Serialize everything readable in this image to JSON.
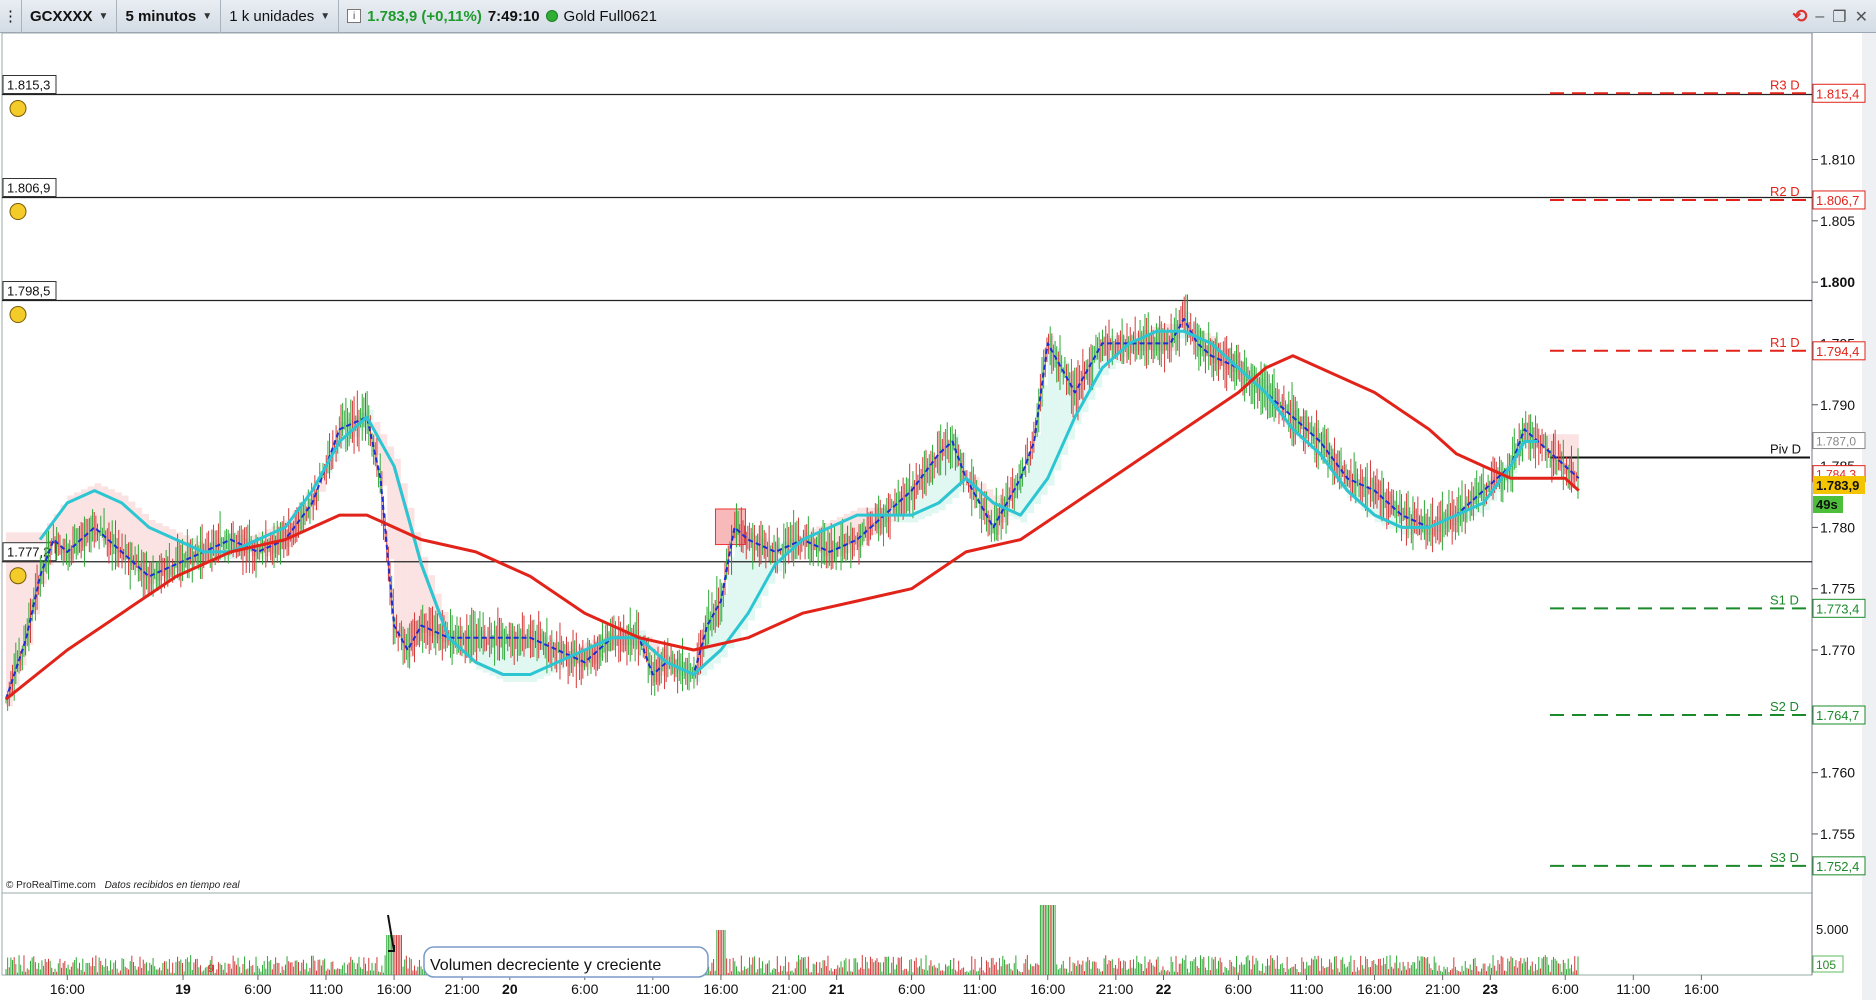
{
  "toolbar": {
    "instrument": "GCXXXX",
    "timeframe": "5 minutos",
    "units": "1 k unidades",
    "price_info": "1.783,9 (+0,11%)",
    "clock": "7:49:10",
    "feed_name": "Gold Full0621"
  },
  "icons": [
    "grip-icon",
    "info-icon",
    "status-dot-icon",
    "sync-icon",
    "minimize-icon",
    "restore-icon",
    "close-icon",
    "bell-icon",
    "arrow-icon"
  ],
  "colors": {
    "sma_slow": "#e2231a",
    "ema_fast": "#2cc6d2",
    "ma_gray": "#999999",
    "dashed_blue": "#1b2fd4",
    "resistance": "#e2231a",
    "support": "#1a8a2a",
    "up_candle": "#2ea836",
    "down_candle": "#d23a3a",
    "last_price_bg": "#f5c400"
  },
  "price_chart": {
    "y_ticks": [
      "1.810",
      "1.805",
      "1.800",
      "1.795",
      "1.790",
      "1.785",
      "1.780",
      "1.775",
      "1.770",
      "1.765",
      "1.760",
      "1.755"
    ],
    "y_min": 1751.0,
    "y_max": 1819.5,
    "horizontal_lines": [
      {
        "label": "1.815,3",
        "value": 1815.3
      },
      {
        "label": "1.806,9",
        "value": 1806.9
      },
      {
        "label": "1.798,5",
        "value": 1798.5
      },
      {
        "label": "1.777,2",
        "value": 1777.2
      }
    ],
    "pivots": [
      {
        "name": "R3 D",
        "value": 1815.4,
        "label": "1.815,4",
        "type": "resistance"
      },
      {
        "name": "R2 D",
        "value": 1806.7,
        "label": "1.806,7",
        "type": "resistance"
      },
      {
        "name": "R1 D",
        "value": 1794.4,
        "label": "1.794,4",
        "type": "resistance"
      },
      {
        "name": "Piv D",
        "value": 1785.7,
        "label": "",
        "type": "pivot"
      },
      {
        "name": "S1 D",
        "value": 1773.4,
        "label": "1.773,4",
        "type": "support"
      },
      {
        "name": "S2 D",
        "value": 1764.7,
        "label": "1.764,7",
        "type": "support"
      },
      {
        "name": "S3 D",
        "value": 1752.4,
        "label": "1.752,4",
        "type": "support"
      }
    ],
    "side_labels": [
      {
        "value": 1787.0,
        "label": "1.787,0"
      },
      {
        "value": 1784.3,
        "label": "1.784,3"
      }
    ],
    "last_price": "1.783,9",
    "countdown": "49s",
    "footer_brand": "© ProRealTime.com",
    "footer_note": "Datos recibidos en tiempo real"
  },
  "volume_chart": {
    "y_tick": "5.000",
    "last_volume": "105",
    "annotation": "Volumen decreciente y creciente",
    "signal_digit": "9"
  },
  "x_axis": {
    "ticks": [
      {
        "label": "16:00",
        "bold": false,
        "t": 0.0
      },
      {
        "label": "19",
        "bold": true,
        "t": 8.5
      },
      {
        "label": "6:00",
        "bold": false,
        "t": 14.0
      },
      {
        "label": "11:00",
        "bold": false,
        "t": 19.0
      },
      {
        "label": "16:00",
        "bold": false,
        "t": 24.0
      },
      {
        "label": "21:00",
        "bold": false,
        "t": 29.0
      },
      {
        "label": "20",
        "bold": true,
        "t": 32.5
      },
      {
        "label": "6:00",
        "bold": false,
        "t": 38.0
      },
      {
        "label": "11:00",
        "bold": false,
        "t": 43.0
      },
      {
        "label": "16:00",
        "bold": false,
        "t": 48.0
      },
      {
        "label": "21:00",
        "bold": false,
        "t": 53.0
      },
      {
        "label": "21",
        "bold": true,
        "t": 56.5
      },
      {
        "label": "6:00",
        "bold": false,
        "t": 62.0
      },
      {
        "label": "11:00",
        "bold": false,
        "t": 67.0
      },
      {
        "label": "16:00",
        "bold": false,
        "t": 72.0
      },
      {
        "label": "21:00",
        "bold": false,
        "t": 77.0
      },
      {
        "label": "22",
        "bold": true,
        "t": 80.5
      },
      {
        "label": "6:00",
        "bold": false,
        "t": 86.0
      },
      {
        "label": "11:00",
        "bold": false,
        "t": 91.0
      },
      {
        "label": "16:00",
        "bold": false,
        "t": 96.0
      },
      {
        "label": "21:00",
        "bold": false,
        "t": 101.0
      },
      {
        "label": "23",
        "bold": true,
        "t": 104.5
      },
      {
        "label": "6:00",
        "bold": false,
        "t": 110.0
      },
      {
        "label": "11:00",
        "bold": false,
        "t": 115.0
      },
      {
        "label": "16:00",
        "bold": false,
        "t": 120.0
      }
    ]
  },
  "chart_data": {
    "type": "line",
    "x_unit": "hours since first label (16:00 day 18)",
    "series": [
      {
        "kind": "price",
        "points": [
          [
            -4.5,
            1766
          ],
          [
            -3,
            1771
          ],
          [
            -2,
            1776
          ],
          [
            -1,
            1779
          ],
          [
            0,
            1778
          ],
          [
            2,
            1780
          ],
          [
            4,
            1778
          ],
          [
            6,
            1776
          ],
          [
            8,
            1777
          ],
          [
            10,
            1778
          ],
          [
            12,
            1779
          ],
          [
            14,
            1778
          ],
          [
            16,
            1779
          ],
          [
            18,
            1782
          ],
          [
            20,
            1788
          ],
          [
            22,
            1789
          ],
          [
            23,
            1784
          ],
          [
            24,
            1772
          ],
          [
            25,
            1770
          ],
          [
            26,
            1772
          ],
          [
            28,
            1771
          ],
          [
            30,
            1771
          ],
          [
            32,
            1771
          ],
          [
            34,
            1771
          ],
          [
            36,
            1770
          ],
          [
            38,
            1769
          ],
          [
            40,
            1771
          ],
          [
            42,
            1771
          ],
          [
            43,
            1768
          ],
          [
            44,
            1769
          ],
          [
            46,
            1768
          ],
          [
            47,
            1772
          ],
          [
            48,
            1774
          ],
          [
            49,
            1780
          ],
          [
            50,
            1779
          ],
          [
            52,
            1778
          ],
          [
            54,
            1779
          ],
          [
            56,
            1778
          ],
          [
            58,
            1779
          ],
          [
            60,
            1781
          ],
          [
            62,
            1783
          ],
          [
            64,
            1786
          ],
          [
            65,
            1787
          ],
          [
            66,
            1784
          ],
          [
            68,
            1780
          ],
          [
            69,
            1782
          ],
          [
            70,
            1784
          ],
          [
            71,
            1787
          ],
          [
            72,
            1795
          ],
          [
            73,
            1793
          ],
          [
            74,
            1791
          ],
          [
            75,
            1793
          ],
          [
            76,
            1795
          ],
          [
            78,
            1795
          ],
          [
            80,
            1795
          ],
          [
            81,
            1795
          ],
          [
            82,
            1797
          ],
          [
            83,
            1795
          ],
          [
            84,
            1794
          ],
          [
            86,
            1793
          ],
          [
            88,
            1791
          ],
          [
            90,
            1789
          ],
          [
            92,
            1787
          ],
          [
            94,
            1784
          ],
          [
            96,
            1783
          ],
          [
            98,
            1781
          ],
          [
            100,
            1780
          ],
          [
            102,
            1781
          ],
          [
            104,
            1783
          ],
          [
            106,
            1785
          ],
          [
            107,
            1788
          ],
          [
            108,
            1787
          ],
          [
            110,
            1785
          ],
          [
            111,
            1784
          ]
        ]
      },
      {
        "kind": "sma_slow",
        "points": [
          [
            -4.5,
            1766
          ],
          [
            0,
            1770
          ],
          [
            4,
            1773
          ],
          [
            8,
            1776
          ],
          [
            12,
            1778
          ],
          [
            16,
            1779
          ],
          [
            20,
            1781
          ],
          [
            22,
            1781
          ],
          [
            26,
            1779
          ],
          [
            30,
            1778
          ],
          [
            34,
            1776
          ],
          [
            38,
            1773
          ],
          [
            42,
            1771
          ],
          [
            46,
            1770
          ],
          [
            50,
            1771
          ],
          [
            54,
            1773
          ],
          [
            58,
            1774
          ],
          [
            62,
            1775
          ],
          [
            66,
            1778
          ],
          [
            70,
            1779
          ],
          [
            74,
            1782
          ],
          [
            78,
            1785
          ],
          [
            82,
            1788
          ],
          [
            86,
            1791
          ],
          [
            88,
            1793
          ],
          [
            90,
            1794
          ],
          [
            92,
            1793
          ],
          [
            96,
            1791
          ],
          [
            100,
            1788
          ],
          [
            102,
            1786
          ],
          [
            104,
            1785
          ],
          [
            106,
            1784
          ],
          [
            110,
            1784
          ],
          [
            111,
            1783
          ]
        ]
      },
      {
        "kind": "ema_fast",
        "points": [
          [
            -2,
            1779
          ],
          [
            0,
            1782
          ],
          [
            2,
            1783
          ],
          [
            4,
            1782
          ],
          [
            6,
            1780
          ],
          [
            8,
            1779
          ],
          [
            10,
            1778
          ],
          [
            12,
            1778
          ],
          [
            14,
            1779
          ],
          [
            16,
            1780
          ],
          [
            18,
            1783
          ],
          [
            20,
            1787
          ],
          [
            22,
            1789
          ],
          [
            24,
            1785
          ],
          [
            26,
            1777
          ],
          [
            28,
            1771
          ],
          [
            30,
            1769
          ],
          [
            32,
            1768
          ],
          [
            34,
            1768
          ],
          [
            36,
            1769
          ],
          [
            38,
            1770
          ],
          [
            40,
            1771
          ],
          [
            42,
            1771
          ],
          [
            44,
            1769
          ],
          [
            46,
            1768
          ],
          [
            48,
            1770
          ],
          [
            50,
            1773
          ],
          [
            52,
            1777
          ],
          [
            54,
            1779
          ],
          [
            56,
            1780
          ],
          [
            58,
            1781
          ],
          [
            60,
            1781
          ],
          [
            62,
            1781
          ],
          [
            64,
            1782
          ],
          [
            66,
            1784
          ],
          [
            68,
            1782
          ],
          [
            70,
            1781
          ],
          [
            72,
            1784
          ],
          [
            74,
            1789
          ],
          [
            76,
            1793
          ],
          [
            78,
            1795
          ],
          [
            80,
            1796
          ],
          [
            82,
            1796
          ],
          [
            84,
            1795
          ],
          [
            86,
            1793
          ],
          [
            88,
            1791
          ],
          [
            90,
            1788
          ],
          [
            92,
            1786
          ],
          [
            94,
            1783
          ],
          [
            96,
            1781
          ],
          [
            98,
            1780
          ],
          [
            100,
            1780
          ],
          [
            102,
            1781
          ],
          [
            104,
            1782
          ],
          [
            106,
            1785
          ],
          [
            107,
            1787
          ],
          [
            108,
            1787
          ]
        ]
      }
    ]
  }
}
